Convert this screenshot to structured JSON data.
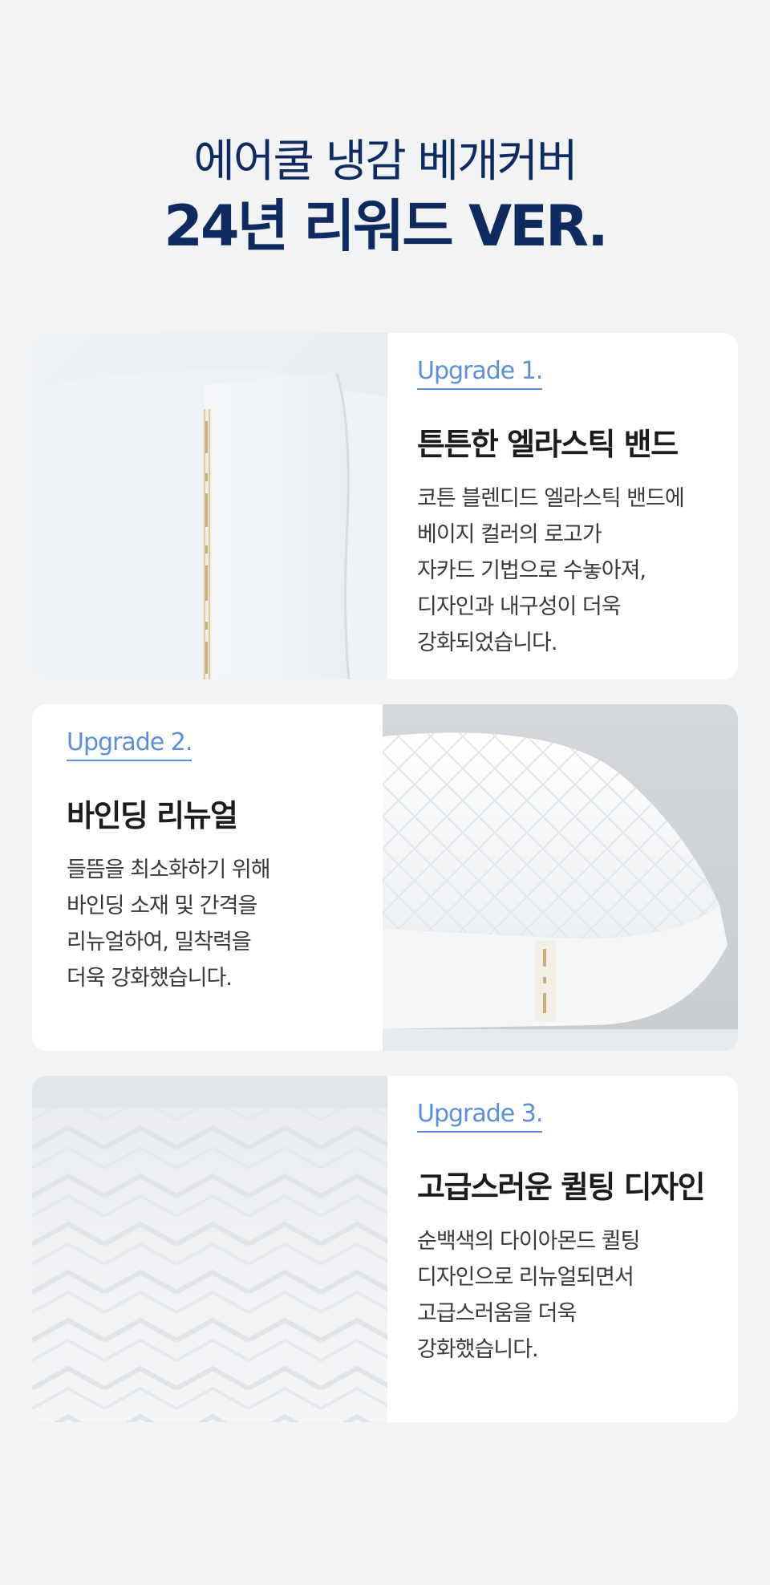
{
  "hero": {
    "line1": "에어쿨 냉감 베개커버",
    "line2": "24년 리워드 VER."
  },
  "cards": [
    {
      "upgrade": "Upgrade 1.",
      "title": "튼튼한 엘라스틱 밴드",
      "body": [
        "코튼 블렌디드 엘라스틱 밴드에",
        "베이지 컬러의 로고가",
        "자카드 기법으로 수놓아져,",
        "디자인과 내구성이 더욱",
        "강화되었습니다."
      ],
      "photo": "elastic-band-photo"
    },
    {
      "upgrade": "Upgrade 2.",
      "title": "바인딩 리뉴얼",
      "body": [
        "들뜸을 최소화하기 위해",
        "바인딩 소재 및 간격을",
        "리뉴얼하여, 밀착력을",
        "더욱 강화했습니다."
      ],
      "photo": "pillow-binding-photo"
    },
    {
      "upgrade": "Upgrade 3.",
      "title": "고급스러운 퀼팅 디자인",
      "body": [
        "순백색의 다이아몬드 퀼팅",
        "디자인으로 리뉴얼되면서",
        "고급스러움을 더욱",
        "강화했습니다."
      ],
      "photo": "quilting-pattern-photo"
    }
  ],
  "colors": {
    "navy": "#0e2a5e",
    "accent_blue": "#5b8fd6",
    "background": "#f2f3f5"
  }
}
